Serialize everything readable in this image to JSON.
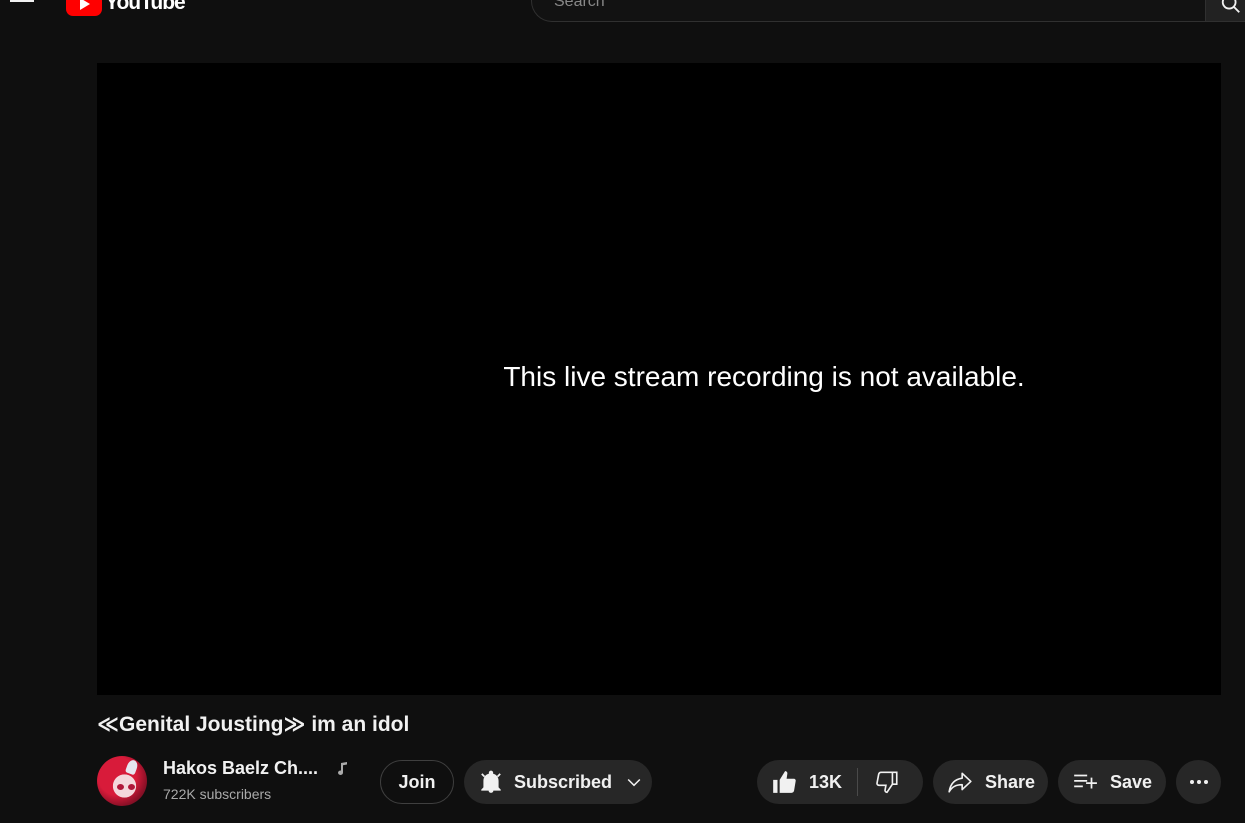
{
  "masthead": {
    "logo_text": "YouTube",
    "search_placeholder": "Search"
  },
  "player": {
    "message": "This live stream recording is not available."
  },
  "video": {
    "title": "≪Genital Jousting≫ im an idol"
  },
  "channel": {
    "name": "Hakos Baelz Ch....",
    "subscribers": "722K subscribers",
    "badge_icon": "music-note-icon"
  },
  "actions": {
    "join_label": "Join",
    "subscribe_label": "Subscribed",
    "like_count": "13K",
    "share_label": "Share",
    "save_label": "Save"
  },
  "colors": {
    "background": "#0f0f0f",
    "button_bg": "#272727",
    "brand_red": "#ff0000",
    "secondary_text": "#aaaaaa"
  }
}
